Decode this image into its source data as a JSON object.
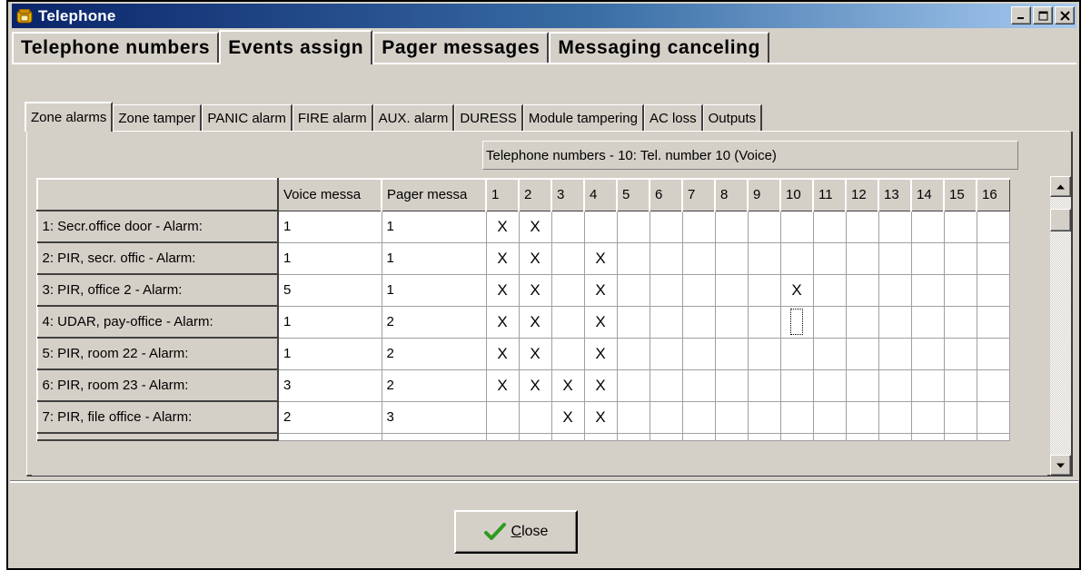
{
  "window": {
    "title": "Telephone"
  },
  "main_tabs": [
    {
      "label": "Telephone numbers",
      "active": false
    },
    {
      "label": "Events assign",
      "active": true
    },
    {
      "label": "Pager messages",
      "active": false
    },
    {
      "label": "Messaging canceling",
      "active": false
    }
  ],
  "sub_tabs": [
    {
      "label": "Zone alarms",
      "active": true
    },
    {
      "label": "Zone tamper",
      "active": false
    },
    {
      "label": "PANIC alarm",
      "active": false
    },
    {
      "label": "FIRE alarm",
      "active": false
    },
    {
      "label": "AUX. alarm",
      "active": false
    },
    {
      "label": "DURESS",
      "active": false
    },
    {
      "label": "Module tampering",
      "active": false
    },
    {
      "label": "AC loss",
      "active": false
    },
    {
      "label": "Outputs",
      "active": false
    }
  ],
  "grid": {
    "group_header": "Telephone numbers -  10: Tel. number 10  (Voice)",
    "columns": {
      "voice": "Voice messa",
      "pager": "Pager messa",
      "numbers": [
        "1",
        "2",
        "3",
        "4",
        "5",
        "6",
        "7",
        "8",
        "9",
        "10",
        "11",
        "12",
        "13",
        "14",
        "15",
        "16"
      ]
    },
    "rows": [
      {
        "label": "1: Secr.office door - Alarm:",
        "voice": "1",
        "pager": "1",
        "checks": [
          "X",
          "X",
          "",
          "",
          "",
          "",
          "",
          "",
          "",
          "",
          "",
          "",
          "",
          "",
          "",
          ""
        ]
      },
      {
        "label": "2: PIR, secr. offic - Alarm:",
        "voice": "1",
        "pager": "1",
        "checks": [
          "X",
          "X",
          "",
          "X",
          "",
          "",
          "",
          "",
          "",
          "",
          "",
          "",
          "",
          "",
          "",
          ""
        ]
      },
      {
        "label": "3: PIR, office 2    - Alarm:",
        "voice": "5",
        "pager": "1",
        "checks": [
          "X",
          "X",
          "",
          "X",
          "",
          "",
          "",
          "",
          "",
          "X",
          "",
          "",
          "",
          "",
          "",
          ""
        ]
      },
      {
        "label": "4: UDAR, pay-office - Alarm:",
        "voice": "1",
        "pager": "2",
        "checks": [
          "X",
          "X",
          "",
          "X",
          "",
          "",
          "",
          "",
          "",
          "",
          "",
          "",
          "",
          "",
          "",
          ""
        ]
      },
      {
        "label": "5: PIR, room 22     - Alarm:",
        "voice": "1",
        "pager": "2",
        "checks": [
          "X",
          "X",
          "",
          "X",
          "",
          "",
          "",
          "",
          "",
          "",
          "",
          "",
          "",
          "",
          "",
          ""
        ]
      },
      {
        "label": "6: PIR, room 23     - Alarm:",
        "voice": "3",
        "pager": "2",
        "checks": [
          "X",
          "X",
          "X",
          "X",
          "",
          "",
          "",
          "",
          "",
          "",
          "",
          "",
          "",
          "",
          "",
          ""
        ]
      },
      {
        "label": "7: PIR, file office - Alarm:",
        "voice": "2",
        "pager": "3",
        "checks": [
          "",
          "",
          "X",
          "X",
          "",
          "",
          "",
          "",
          "",
          "",
          "",
          "",
          "",
          "",
          "",
          ""
        ]
      }
    ],
    "focused_cell": {
      "row": 3,
      "column": "10"
    }
  },
  "buttons": {
    "close_label": "Close"
  },
  "icons": {
    "app": "telephone-icon",
    "close_button": "checkmark-icon"
  },
  "colors": {
    "titlebar_start": "#0a246a",
    "titlebar_end": "#a6caf0",
    "face": "#d4d0c8",
    "check": "#2e9b1f"
  }
}
